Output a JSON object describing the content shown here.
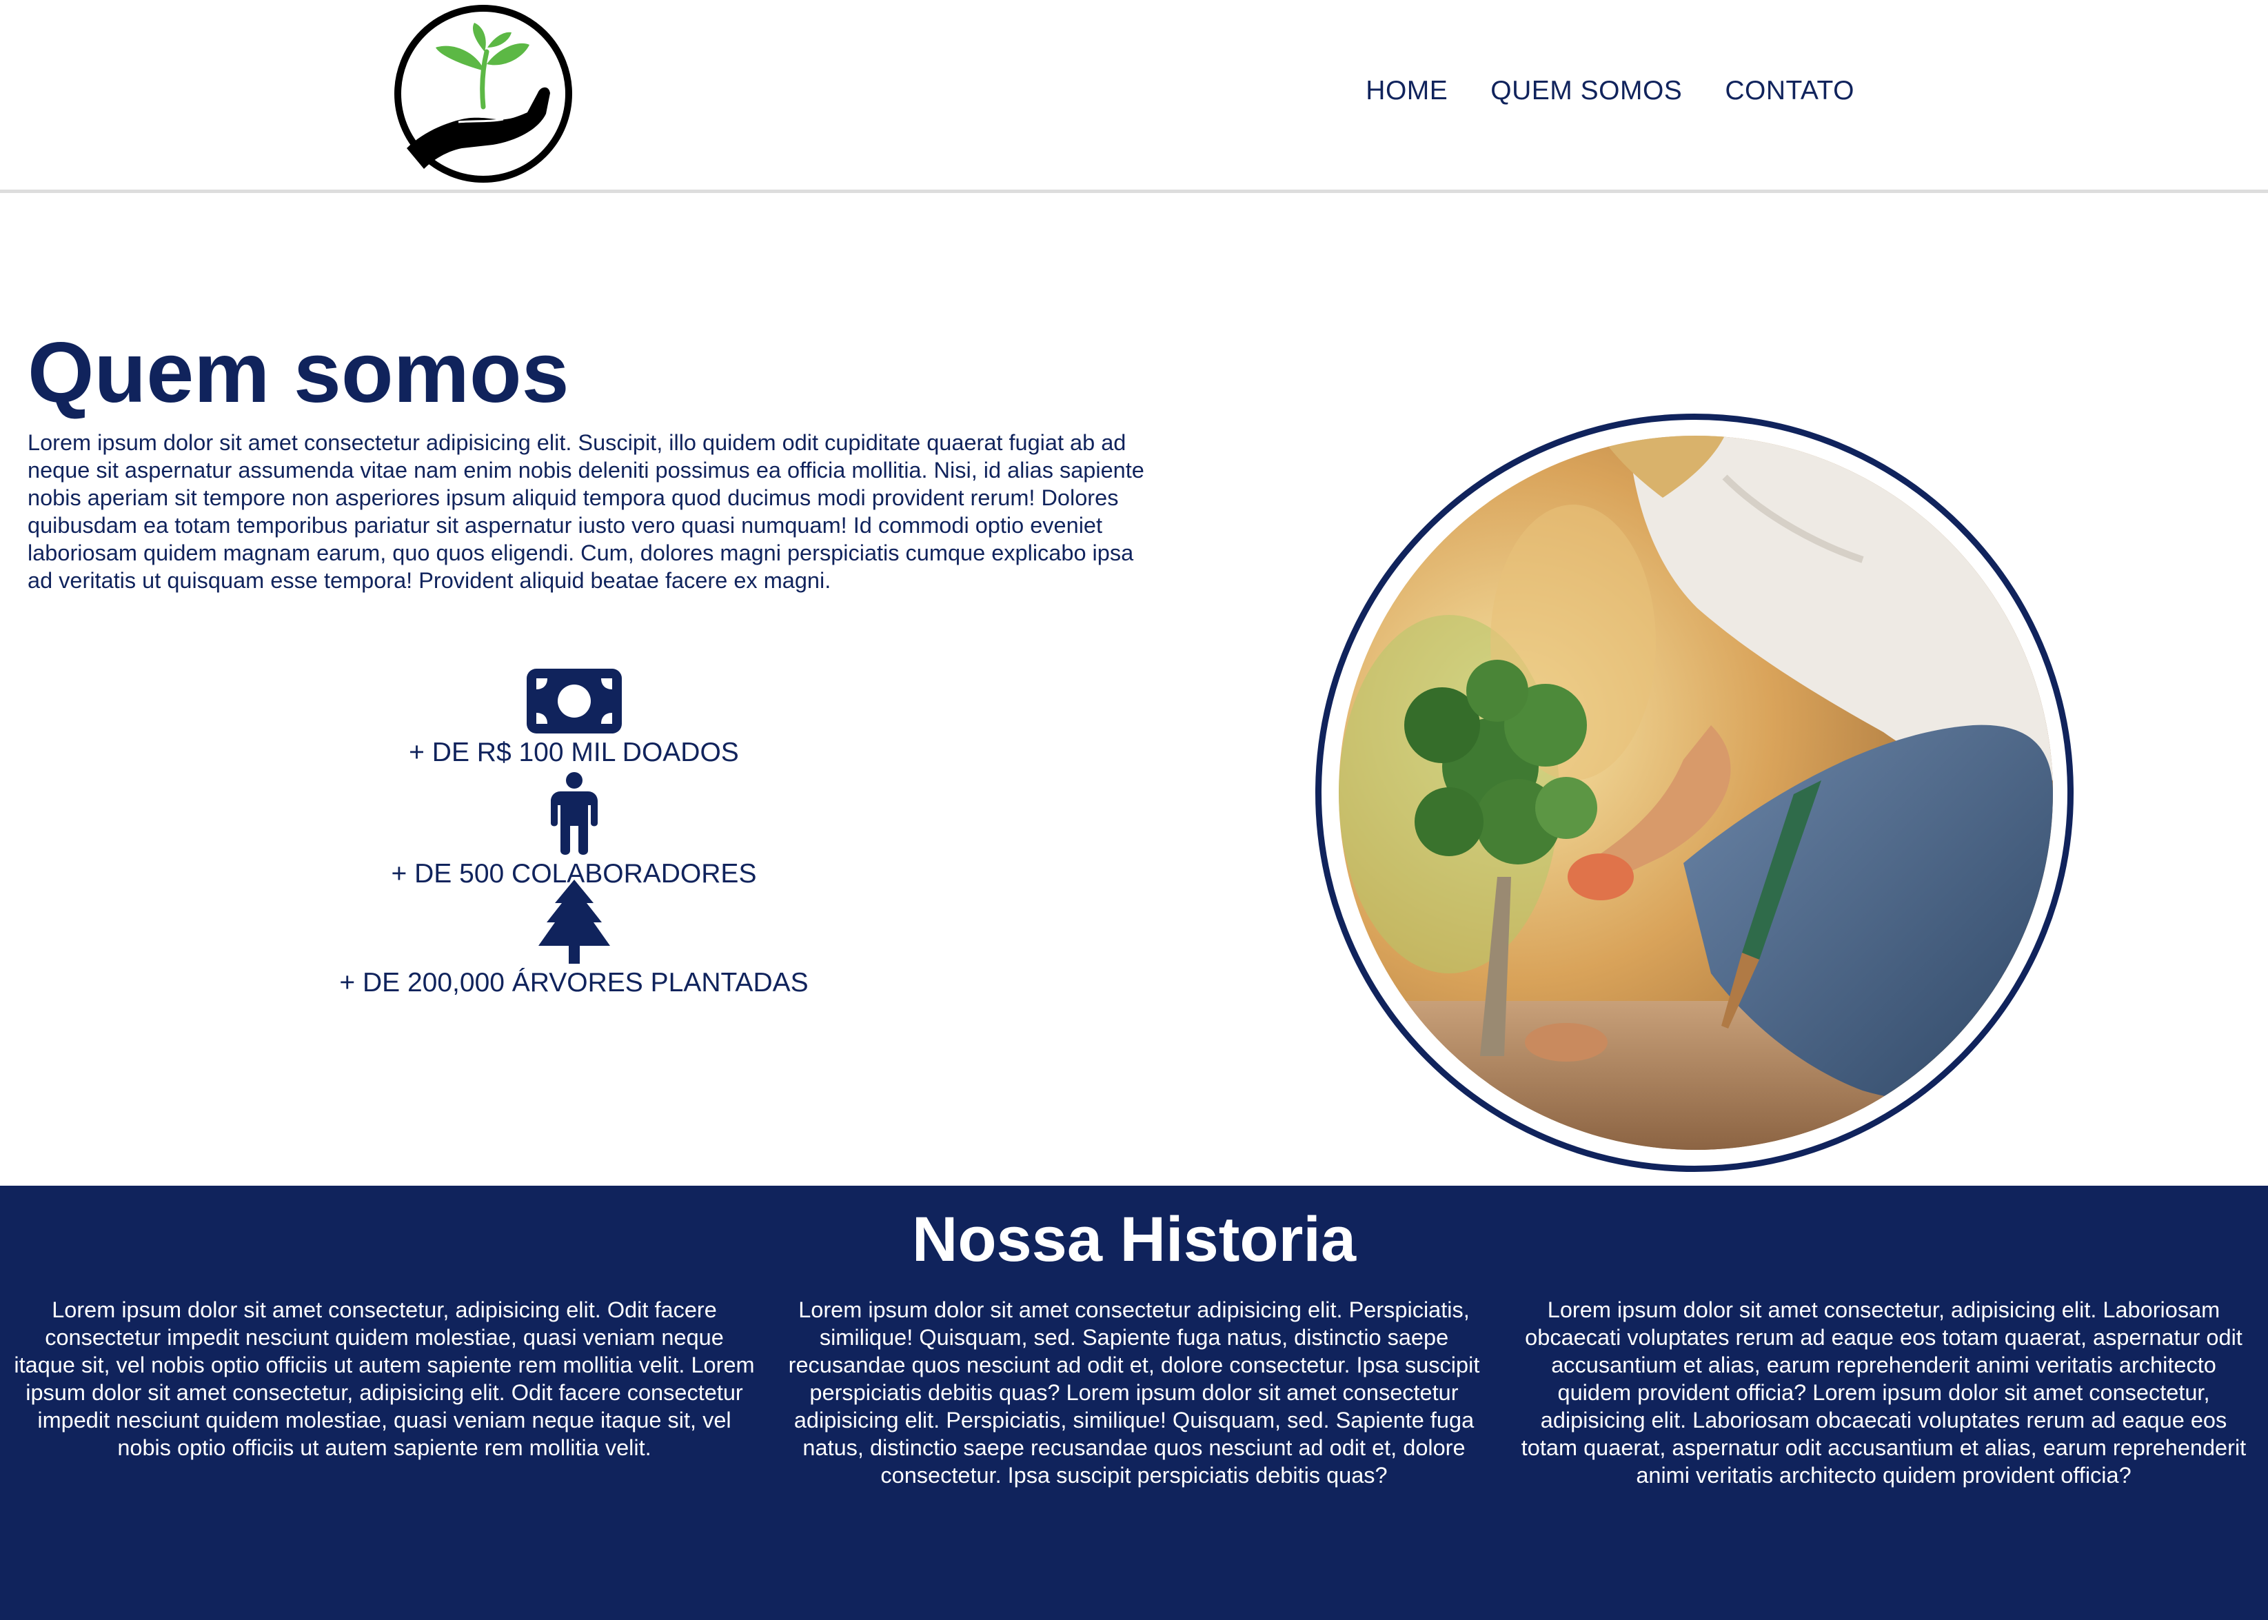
{
  "header": {
    "logo_icon": "hand-holding-plant-icon",
    "nav": [
      {
        "label": "HOME"
      },
      {
        "label": "QUEM SOMOS"
      },
      {
        "label": "CONTATO"
      }
    ]
  },
  "about": {
    "title": "Quem somos",
    "text": "Lorem ipsum dolor sit amet consectetur adipisicing elit. Suscipit, illo quidem odit cupiditate quaerat fugiat ab ad neque sit aspernatur assumenda vitae nam enim nobis deleniti possimus ea officia mollitia. Nisi, id alias sapiente nobis aperiam sit tempore non asperiores ipsum aliquid tempora quod ducimus modi provident rerum! Dolores quibusdam ea totam temporibus pariatur sit aspernatur iusto vero quasi numquam! Id commodi optio eveniet laboriosam quidem magnam earum, quo quos eligendi. Cum, dolores magni perspiciatis cumque explicabo ipsa ad veritatis ut quisquam esse tempora! Provident aliquid beatae facere ex magni.",
    "stats": [
      {
        "icon": "money-bill-icon",
        "label": "+ DE R$ 100 MIL DOADOS"
      },
      {
        "icon": "person-icon",
        "label": "+ DE 500 COLABORADORES"
      },
      {
        "icon": "tree-icon",
        "label": "+ DE 200,000 ÁRVORES PLANTADAS"
      }
    ]
  },
  "history": {
    "title": "Nossa Historia",
    "columns": [
      "Lorem ipsum dolor sit amet consectetur, adipisicing elit. Odit facere consectetur impedit nesciunt quidem molestiae, quasi veniam neque itaque sit, vel nobis optio officiis ut autem sapiente rem mollitia velit. Lorem ipsum dolor sit amet consectetur, adipisicing elit. Odit facere consectetur impedit nesciunt quidem molestiae, quasi veniam neque itaque sit, vel nobis optio officiis ut autem sapiente rem mollitia velit.",
      "Lorem ipsum dolor sit amet consectetur adipisicing elit. Perspiciatis, similique! Quisquam, sed. Sapiente fuga natus, distinctio saepe recusandae quos nesciunt ad odit et, dolore consectetur. Ipsa suscipit perspiciatis debitis quas? Lorem ipsum dolor sit amet consectetur adipisicing elit. Perspiciatis, similique! Quisquam, sed. Sapiente fuga natus, distinctio saepe recusandae quos nesciunt ad odit et, dolore consectetur. Ipsa suscipit perspiciatis debitis quas?",
      "Lorem ipsum dolor sit amet consectetur, adipisicing elit. Laboriosam obcaecati voluptates rerum ad eaque eos totam quaerat, aspernatur odit accusantium et alias, earum reprehenderit animi veritatis architecto quidem provident officia? Lorem ipsum dolor sit amet consectetur, adipisicing elit. Laboriosam obcaecati voluptates rerum ad eaque eos totam quaerat, aspernatur odit accusantium et alias, earum reprehenderit animi veritatis architecto quidem provident officia?"
    ]
  },
  "colors": {
    "brand_navy": "#10235c",
    "leaf_green": "#5cb845",
    "header_border": "#dddddd"
  }
}
